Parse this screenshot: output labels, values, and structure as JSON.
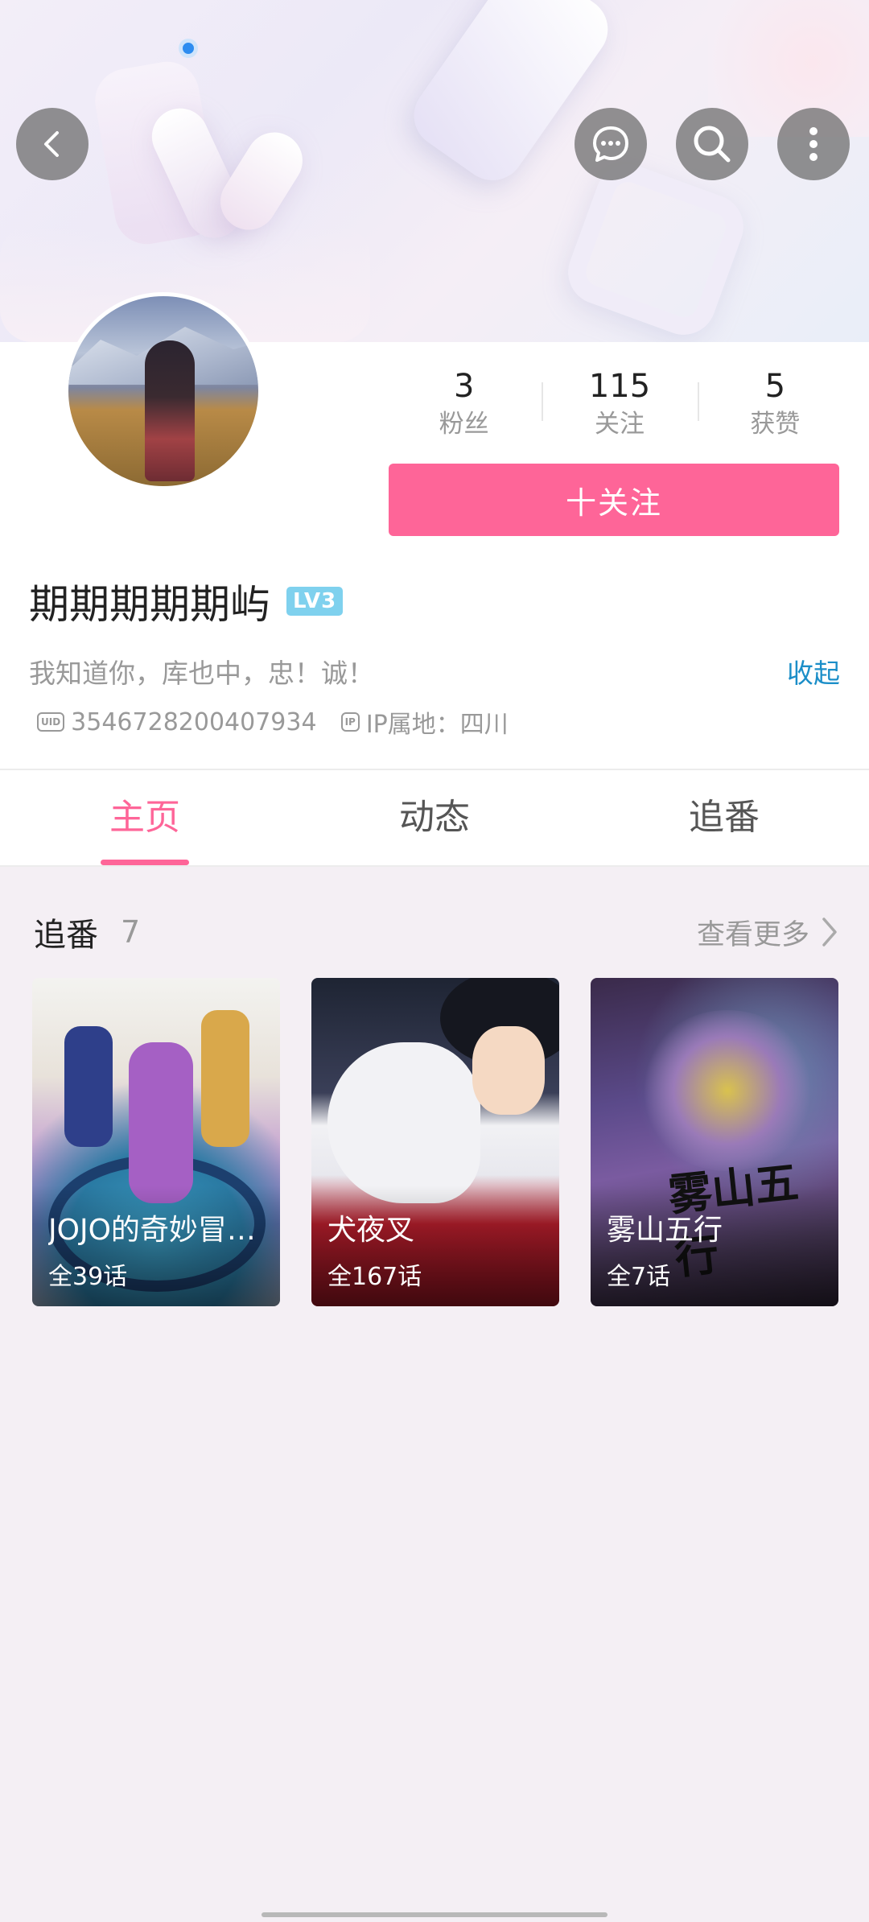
{
  "header": {
    "back_icon": "chevron-left-icon",
    "message_icon": "chat-bubble-icon",
    "search_icon": "search-icon",
    "more_icon": "more-vertical-icon"
  },
  "profile": {
    "stats": [
      {
        "value": "3",
        "label": "粉丝"
      },
      {
        "value": "115",
        "label": "关注"
      },
      {
        "value": "5",
        "label": "获赞"
      }
    ],
    "follow_label": "十关注",
    "username": "期期期期期屿",
    "level_badge": "LV3",
    "bio": "我知道你，库也中，忠！诚！",
    "collapse_label": "收起",
    "uid_icon": "UID",
    "uid": "3546728200407934",
    "ip_icon": "IP",
    "ip_location": "IP属地：四川"
  },
  "tabs": [
    {
      "label": "主页",
      "active": true
    },
    {
      "label": "动态",
      "active": false
    },
    {
      "label": "追番",
      "active": false
    }
  ],
  "following_section": {
    "title": "追番",
    "count": "7",
    "see_more_label": "查看更多",
    "items": [
      {
        "title": "JOJO的奇妙冒险 黄金之风",
        "episodes": "全39话"
      },
      {
        "title": "犬夜叉",
        "episodes": "全167话"
      },
      {
        "title": "雾山五行",
        "episodes": "全7话",
        "logo_text": "雾山五行"
      }
    ]
  },
  "colors": {
    "accent_pink": "#fe6598",
    "link_blue": "#1b8ec8",
    "level_badge": "#7fd1ee"
  }
}
